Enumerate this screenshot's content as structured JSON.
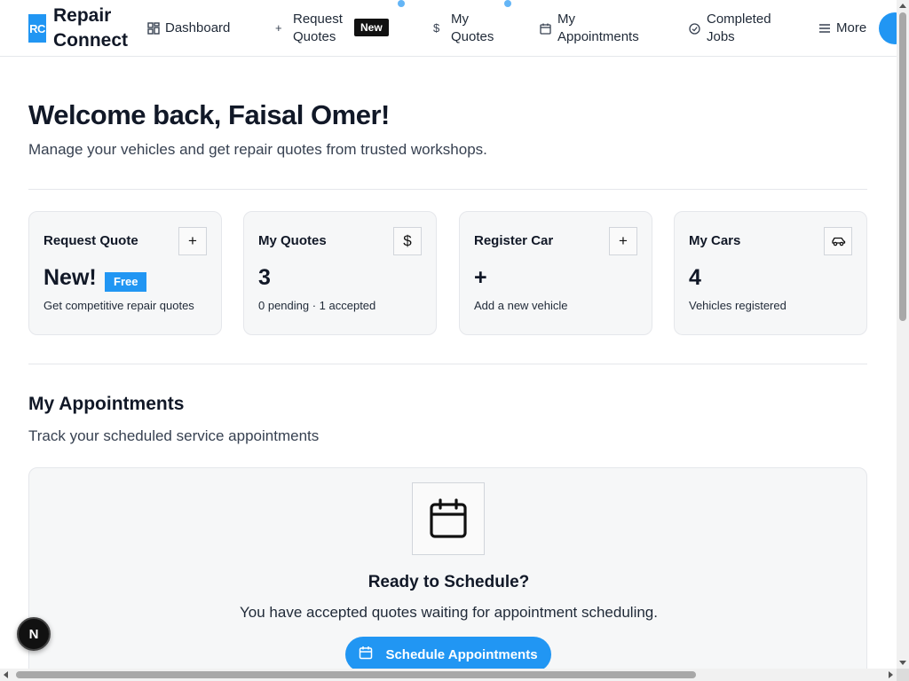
{
  "app": {
    "logo_initials": "RC",
    "name": "Repair Connect"
  },
  "nav": {
    "items": [
      {
        "id": "dashboard",
        "label": "Dashboard",
        "icon": "dashboard-grid-icon"
      },
      {
        "id": "request-quotes",
        "label": "Request\nQuotes",
        "icon": "plus-icon",
        "badge": "New"
      },
      {
        "id": "my-quotes",
        "label": "My\nQuotes",
        "icon": "dollar-icon"
      },
      {
        "id": "my-appointments",
        "label": "My\nAppointments",
        "icon": "calendar-icon"
      },
      {
        "id": "completed-jobs",
        "label": "Completed\nJobs",
        "icon": "check-circle-icon"
      },
      {
        "id": "more",
        "label": "More",
        "icon": "menu-icon"
      }
    ]
  },
  "welcome": {
    "title": "Welcome back, Faisal Omer!",
    "subtitle": "Manage your vehicles and get repair quotes from trusted workshops."
  },
  "cards": [
    {
      "title": "Request Quote",
      "value": "New!",
      "badge": "Free",
      "desc": "Get competitive repair quotes",
      "icon": "plus-icon",
      "glyph": "+"
    },
    {
      "title": "My Quotes",
      "value": "3",
      "desc": "0 pending · 1 accepted",
      "icon": "dollar-icon",
      "glyph": "$"
    },
    {
      "title": "Register Car",
      "value": "+",
      "desc": "Add a new vehicle",
      "icon": "plus-icon",
      "glyph": "+"
    },
    {
      "title": "My Cars",
      "value": "4",
      "desc": "Vehicles registered",
      "icon": "car-icon",
      "glyph": ""
    }
  ],
  "appointments": {
    "title": "My Appointments",
    "subtitle": "Track your scheduled service appointments",
    "empty_title": "Ready to Schedule?",
    "empty_subtitle": "You have accepted quotes waiting for appointment scheduling.",
    "button_label": "Schedule Appointments"
  },
  "dev_badge": "N",
  "colors": {
    "accent": "#2196f3",
    "card_bg": "#f6f7f8",
    "border": "#e5e7eb"
  }
}
